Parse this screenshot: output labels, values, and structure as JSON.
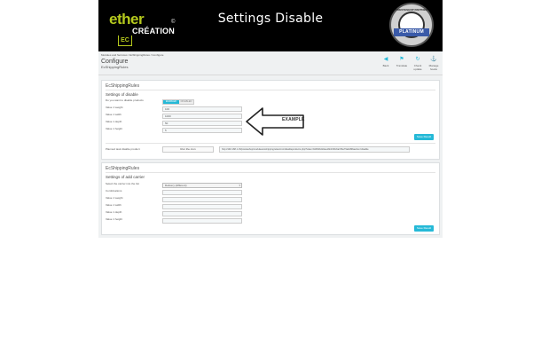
{
  "banner": {
    "title": "Settings Disable",
    "logo_ether": "ether",
    "logo_creation": "CRÉATION",
    "logo_ec": "EC",
    "logo_copyright": "©",
    "badge_ribbon": "PLATINUM",
    "badge_top": "PRESTASHOP PARTNER"
  },
  "header": {
    "breadcrumb": "Modules and Services  /  EcShippingRules  /  Configure",
    "title": "Configure",
    "subtitle": "EcShippingRules",
    "toolbar": [
      {
        "label": "Back",
        "icon": "back-icon",
        "glyph": "◀"
      },
      {
        "label": "Translate",
        "icon": "flag-icon",
        "glyph": "⚑"
      },
      {
        "label": "Check update",
        "icon": "refresh-icon",
        "glyph": "↻"
      },
      {
        "label": "Manage hooks",
        "icon": "anchor-icon",
        "glyph": "⚓"
      }
    ]
  },
  "panel1": {
    "heading": "EcShippingRules",
    "subheading": "Settings of disable",
    "toggle_label": "Do you want to disable products",
    "toggle_on": "ENABLED",
    "toggle_off": "DISABLED",
    "fields": [
      {
        "label": "Value 1 weight",
        "value": "100"
      },
      {
        "label": "Value 1 width",
        "value": "1000"
      },
      {
        "label": "Value 1 depth",
        "value": "50"
      },
      {
        "label": "Value 1 height",
        "value": "5"
      }
    ],
    "save_label": "Save Result",
    "url_label": "Planned task disable product",
    "url_button": "Run the cron",
    "url_value": "http://192.168.1.15/prestashop/modules/ecshippingrules/cron/disableproducts.php?token=fa5b9b4d4ea1bb16f2c6a7d6e79a9c8f&action=disable"
  },
  "panel2": {
    "heading": "EcShippingRules",
    "subheading": "Settings of add carrier",
    "select_label": "Select the carrier into the list",
    "select_value": "Delivery (different)",
    "second_label": "Combinations",
    "fields": [
      {
        "label": "Value 1 weight",
        "value": ""
      },
      {
        "label": "Value 1 width",
        "value": ""
      },
      {
        "label": "Value 1 depth",
        "value": ""
      },
      {
        "label": "Value 1 height",
        "value": ""
      }
    ],
    "save_label": "Save Result"
  },
  "annotation": {
    "example_label": "EXAMPLE"
  }
}
